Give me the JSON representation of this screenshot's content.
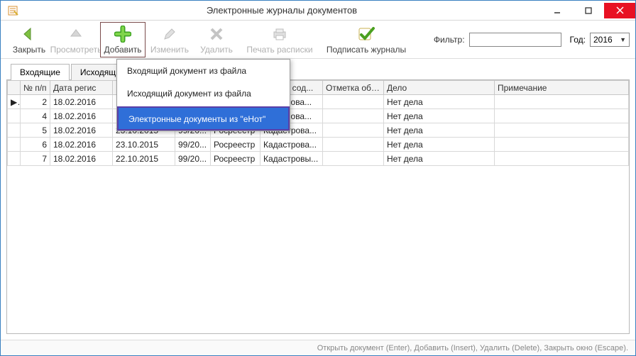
{
  "window": {
    "title": "Электронные журналы документов"
  },
  "toolbar": {
    "close": "Закрыть",
    "view": "Просмотреть",
    "add": "Добавить",
    "edit": "Изменить",
    "delete": "Удалить",
    "print": "Печать расписки",
    "sign": "Подписать журналы",
    "filter_label": "Фильтр:",
    "filter_value": "",
    "year_label": "Год:",
    "year_value": "2016"
  },
  "addmenu": {
    "i1": "Входящий документ из файла",
    "i2": "Исходящий документ из файла",
    "i3": "Электронные документы из \"еНот\""
  },
  "tabs": {
    "incoming": "Входящие",
    "outgoing": "Исходящие"
  },
  "columns": {
    "n": "№ п/п",
    "regdate": "Дата регис",
    "docdate": "",
    "num": "",
    "sender": "",
    "summary": "раткое сод...",
    "mark": "Отметка об ...",
    "case": "Дело",
    "note": "Примечание"
  },
  "rows": [
    {
      "mark": "▶",
      "n": "2",
      "regdate": "18.02.2016",
      "docdate": "",
      "num": "",
      "sender": "",
      "summary": "адастрова...",
      "case": "Нет дела"
    },
    {
      "mark": "",
      "n": "4",
      "regdate": "18.02.2016",
      "docdate": "",
      "num": "",
      "sender": "",
      "summary": "адастрова...",
      "case": "Нет дела"
    },
    {
      "mark": "",
      "n": "5",
      "regdate": "18.02.2016",
      "docdate": "23.10.2015",
      "num": "99/20...",
      "sender": "Росреестр",
      "summary": "Кадастрова...",
      "case": "Нет дела"
    },
    {
      "mark": "",
      "n": "6",
      "regdate": "18.02.2016",
      "docdate": "23.10.2015",
      "num": "99/20...",
      "sender": "Росреестр",
      "summary": "Кадастрова...",
      "case": "Нет дела"
    },
    {
      "mark": "",
      "n": "7",
      "regdate": "18.02.2016",
      "docdate": "22.10.2015",
      "num": "99/20...",
      "sender": "Росреестр",
      "summary": "Кадастровы...",
      "case": "Нет дела"
    }
  ],
  "status": "Открыть документ (Enter), Добавить (Insert), Удалить (Delete), Закрыть окно (Escape)."
}
